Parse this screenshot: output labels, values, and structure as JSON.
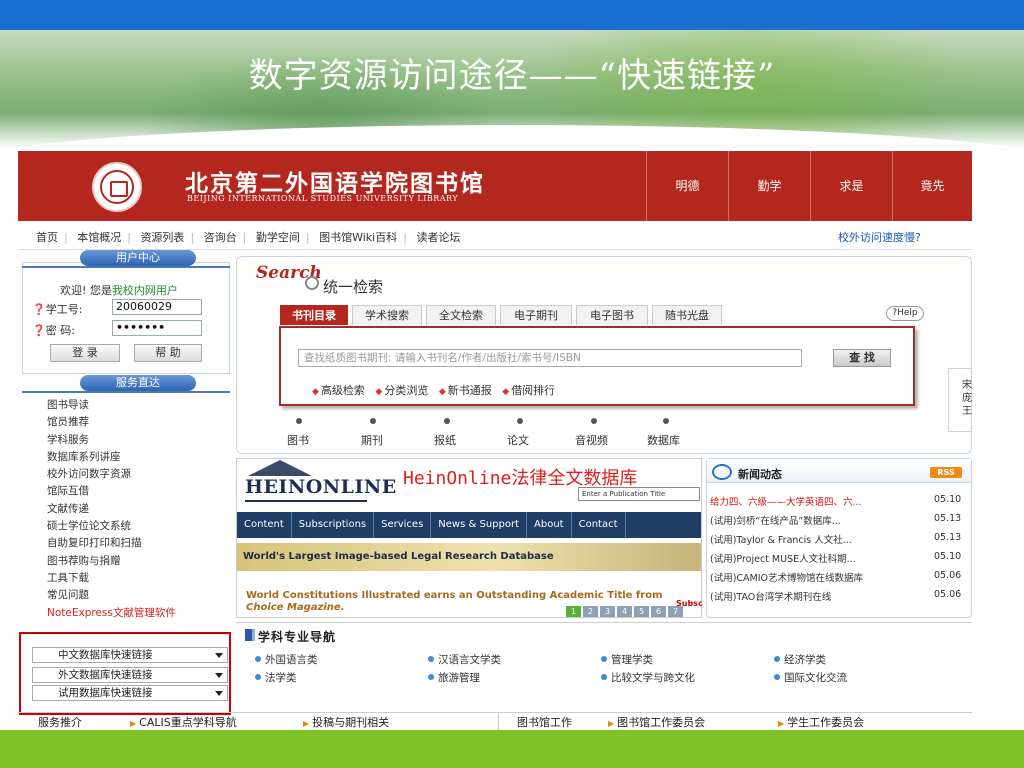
{
  "slide": {
    "title": "数字资源访问途径——“快速链接”"
  },
  "colors": {
    "slide_top_bar": "#1a6fd0",
    "slide_bottom_bar": "#7ec326",
    "header_red": "#b4271e",
    "panel_blue": "#2d64b4",
    "highlight_box": "#cc0000"
  },
  "site": {
    "name_cn": "北京第二外国语学院图书馆",
    "name_en": "BEIJING INTERNATIONAL STUDIES UNIVERSITY LIBRARY",
    "mottos": [
      "明德",
      "勤学",
      "求是",
      "竟先"
    ]
  },
  "nav": {
    "items": [
      "首页",
      "本馆概况",
      "资源列表",
      "咨询台",
      "勤学空间",
      "图书馆Wiki百科",
      "读者论坛"
    ],
    "slow_link": "校外访问速度慢?"
  },
  "user_center": {
    "title": "用户中心",
    "welcome_prefix": "欢迎! 您是",
    "welcome_user": "我校内网用户",
    "id_label": "学工号:",
    "id_value": "20060029",
    "pwd_label": "密  码:",
    "pwd_value": "•••••••",
    "login": "登 录",
    "help": "帮 助"
  },
  "services": {
    "title": "服务直达",
    "items": [
      "图书导读",
      "馆员推荐",
      "学科服务",
      "数据库系列讲座",
      "校外访问数字资源",
      "馆际互借",
      "文献传递",
      "硕士学位论文系统",
      "自助复印打印和扫描",
      "图书荐购与捐赠",
      "工具下载",
      "常见问题",
      "NoteExpress文献管理软件"
    ]
  },
  "quick_links": [
    "中文数据库快速链接",
    "外文数据库快速链接",
    "试用数据库快速链接"
  ],
  "search": {
    "word": "Search",
    "title": "统一检索",
    "tabs": [
      "书刊目录",
      "学术搜索",
      "全文检索",
      "电子期刊",
      "电子图书",
      "随书光盘"
    ],
    "help": "?Help",
    "placeholder": "查找纸质图书期刊: 请输入书刊名/作者/出版社/索书号/ISBN",
    "button": "查 找",
    "links": [
      "高级检索",
      "分类浏览",
      "新书通报",
      "借阅排行"
    ],
    "categories": [
      "图书",
      "期刊",
      "报纸",
      "论文",
      "音视频",
      "数据库"
    ],
    "side_peek": [
      "宋",
      "庞",
      "王"
    ]
  },
  "hein": {
    "logo": "HEINONLINE",
    "title": "HeinOnline法律全文数据库",
    "pub_placeholder": "Enter a Publication Title",
    "nav": [
      "Content",
      "Subscriptions",
      "Services",
      "News & Support",
      "About",
      "Contact"
    ],
    "band": "World's Largest Image-based Legal Research Database",
    "news_line1": "World Constitutions Illustrated earns an Outstanding Academic Title from",
    "news_line2": "Choice Magazine.",
    "subs": "Subsc",
    "pages": [
      "1",
      "2",
      "3",
      "4",
      "5",
      "6",
      "7"
    ]
  },
  "news": {
    "title": "新闻动态",
    "rss": "RSS",
    "items": [
      {
        "text": "给力四、六级——大学英语四、六...",
        "date": "05.10",
        "hot": true
      },
      {
        "text": "(试用)剑桥“在线产品”数据库...",
        "date": "05.13",
        "hot": false
      },
      {
        "text": "(试用)Taylor & Francis 人文社...",
        "date": "05.13",
        "hot": false
      },
      {
        "text": "(试用)Project MUSE人文社科期...",
        "date": "05.10",
        "hot": false
      },
      {
        "text": "(试用)CAMIO艺术博物馆在线数据库",
        "date": "05.06",
        "hot": false
      },
      {
        "text": "(试用)TAO台湾学术期刊在线",
        "date": "05.06",
        "hot": false
      }
    ]
  },
  "subjects": {
    "title": "学科专业导航",
    "row1": [
      "外国语言类",
      "汉语言文学类",
      "管理学类",
      "经济学类"
    ],
    "row2": [
      "法学类",
      "旅游管理",
      "比较文学与跨文化",
      "国际文化交流"
    ]
  },
  "bottom": {
    "service_title": "服务推介",
    "service_links": [
      "CALIS重点学科导航",
      "投稿与期刊相关"
    ],
    "work_title": "图书馆工作",
    "work_links": [
      "图书馆工作委员会",
      "学生工作委员会"
    ]
  }
}
